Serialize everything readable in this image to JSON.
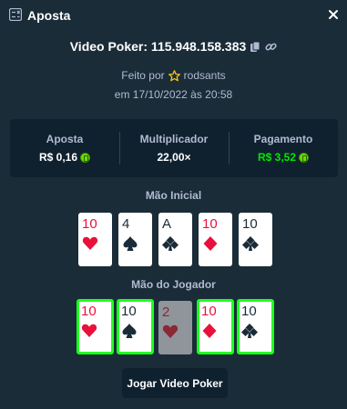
{
  "modal": {
    "title": "Aposta",
    "close_icon": "close-icon",
    "title_icon": "bet-slip-icon"
  },
  "bet": {
    "id_text": "Video Poker: 115.948.158.383",
    "copy_icon": "copy-icon",
    "link_icon": "link-icon",
    "made_by_prefix": "Feito por",
    "user_icon": "star-icon",
    "username": "rodsants",
    "date": "em 17/10/2022 às 20:58"
  },
  "stats": {
    "bet_label": "Aposta",
    "bet_value": "R$ 0,16",
    "multiplier_label": "Multiplicador",
    "multiplier_value": "22,00×",
    "payout_label": "Pagamento",
    "payout_value": "R$ 3,52",
    "currency_icon": "brl-coin-icon",
    "payout_color": "#00e701"
  },
  "initial_hand": {
    "label": "Mão Inicial",
    "cards": [
      {
        "rank": "10",
        "suit": "hearts",
        "color": "red"
      },
      {
        "rank": "4",
        "suit": "spades",
        "color": "black"
      },
      {
        "rank": "A",
        "suit": "clubs",
        "color": "black"
      },
      {
        "rank": "10",
        "suit": "diamonds",
        "color": "red"
      },
      {
        "rank": "10",
        "suit": "clubs",
        "color": "black"
      }
    ]
  },
  "player_hand": {
    "label": "Mão do Jogador",
    "cards": [
      {
        "rank": "10",
        "suit": "hearts",
        "color": "red",
        "held": true
      },
      {
        "rank": "10",
        "suit": "spades",
        "color": "black",
        "held": true
      },
      {
        "rank": "2",
        "suit": "hearts",
        "color": "red",
        "held": false
      },
      {
        "rank": "10",
        "suit": "diamonds",
        "color": "red",
        "held": true
      },
      {
        "rank": "10",
        "suit": "clubs",
        "color": "black",
        "held": true
      }
    ]
  },
  "play_button": {
    "label": "Jogar Video Poker"
  },
  "colors": {
    "background": "#1a2c38",
    "panel": "#0f212e",
    "held_border": "#1fff20",
    "red_suit": "#e9113c",
    "black_suit": "#1a2c38"
  }
}
